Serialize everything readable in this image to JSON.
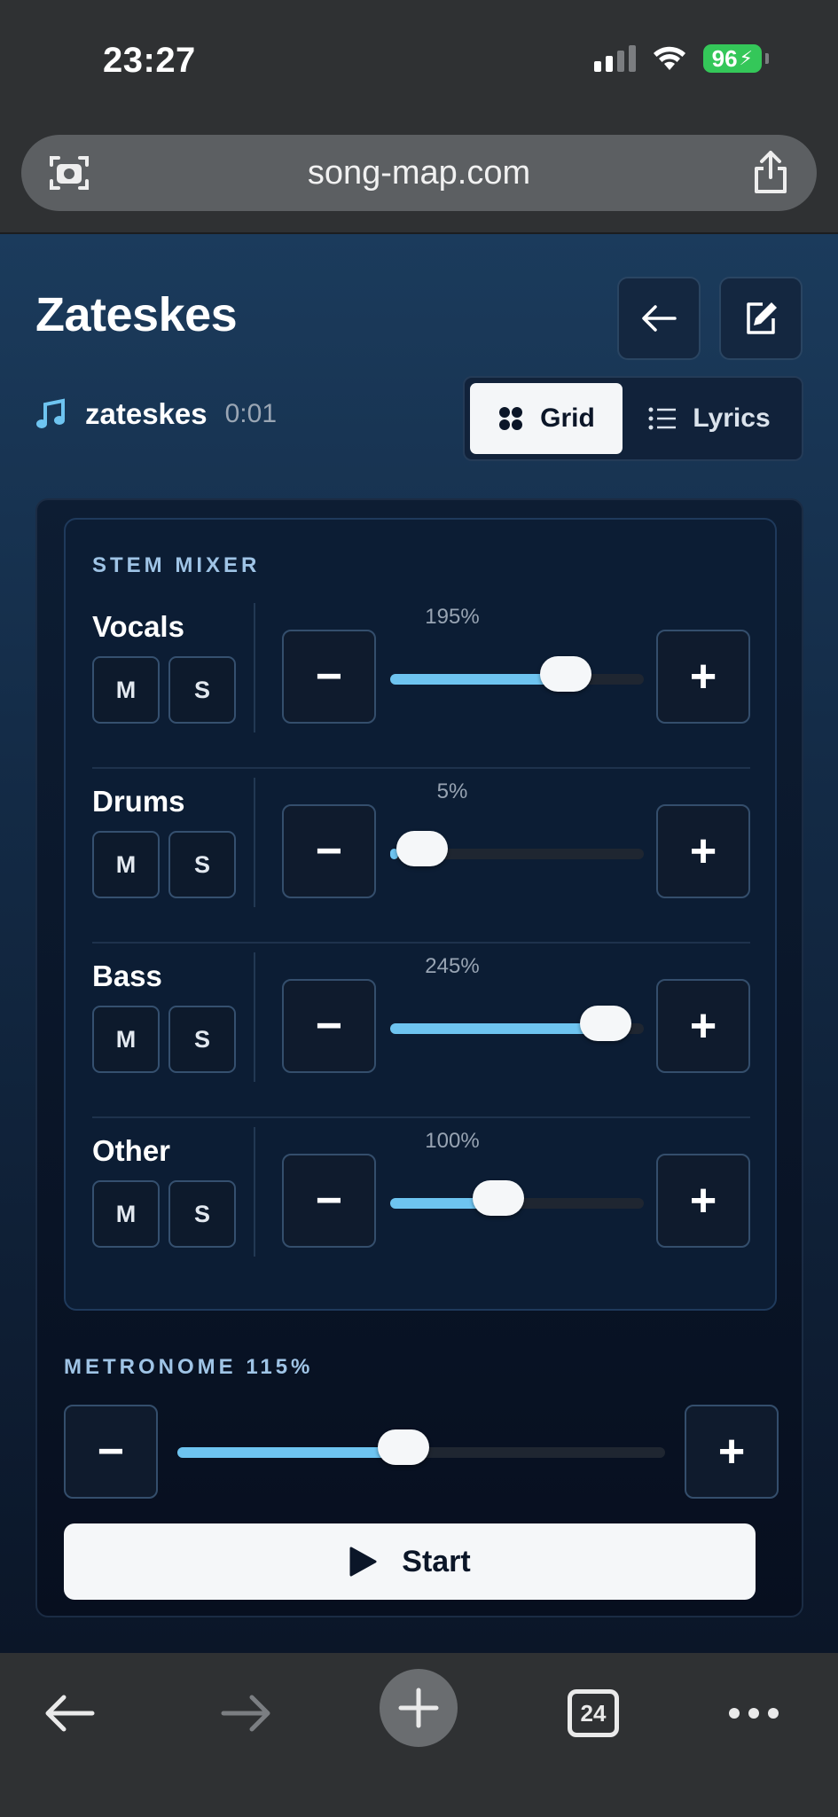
{
  "status_bar": {
    "time": "23:27",
    "battery": "96"
  },
  "browser": {
    "url": "song-map.com",
    "tab_count": "24"
  },
  "header": {
    "title": "Zateskes",
    "artist": "zateskes",
    "duration": "0:01"
  },
  "view_toggle": {
    "grid_label": "Grid",
    "lyrics_label": "Lyrics",
    "selected": "Grid"
  },
  "stem_mixer": {
    "label": "STEM MIXER",
    "mute_label": "M",
    "solo_label": "S",
    "minus_label": "−",
    "plus_label": "+",
    "stems": [
      {
        "name": "Vocals",
        "percent": "195%",
        "level": 0.74
      },
      {
        "name": "Drums",
        "percent": "5%",
        "level": 0.03
      },
      {
        "name": "Bass",
        "percent": "245%",
        "level": 0.94
      },
      {
        "name": "Other",
        "percent": "100%",
        "level": 0.41
      }
    ]
  },
  "metronome": {
    "label": "METRONOME 115%",
    "level": 0.46
  },
  "start_button": {
    "label": "Start"
  },
  "colors": {
    "accent": "#6ec4f0",
    "battery": "#34c759"
  }
}
